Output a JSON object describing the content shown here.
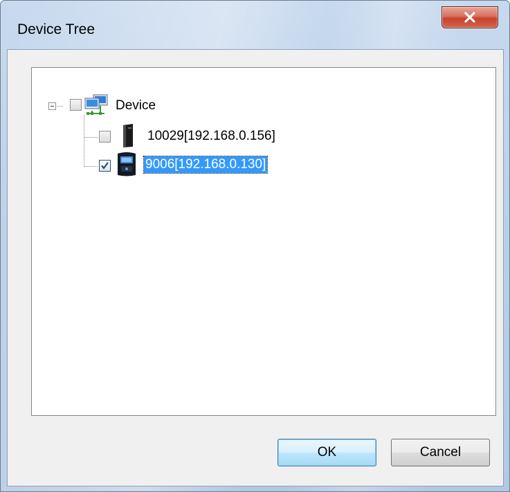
{
  "window": {
    "title": "Device Tree"
  },
  "tree": {
    "root": {
      "label": "Device",
      "expanded": true,
      "checked": false,
      "icon": "network-computers-icon"
    },
    "children": [
      {
        "label": "10029[192.168.0.156]",
        "checked": false,
        "selected": false,
        "icon": "tower-device-icon"
      },
      {
        "label": "9006[192.168.0.130]",
        "checked": true,
        "selected": true,
        "icon": "terminal-device-icon"
      }
    ]
  },
  "buttons": {
    "ok_label": "OK",
    "cancel_label": "Cancel"
  },
  "colors": {
    "selection": "#3399ff",
    "close_button": "#c6422d"
  }
}
